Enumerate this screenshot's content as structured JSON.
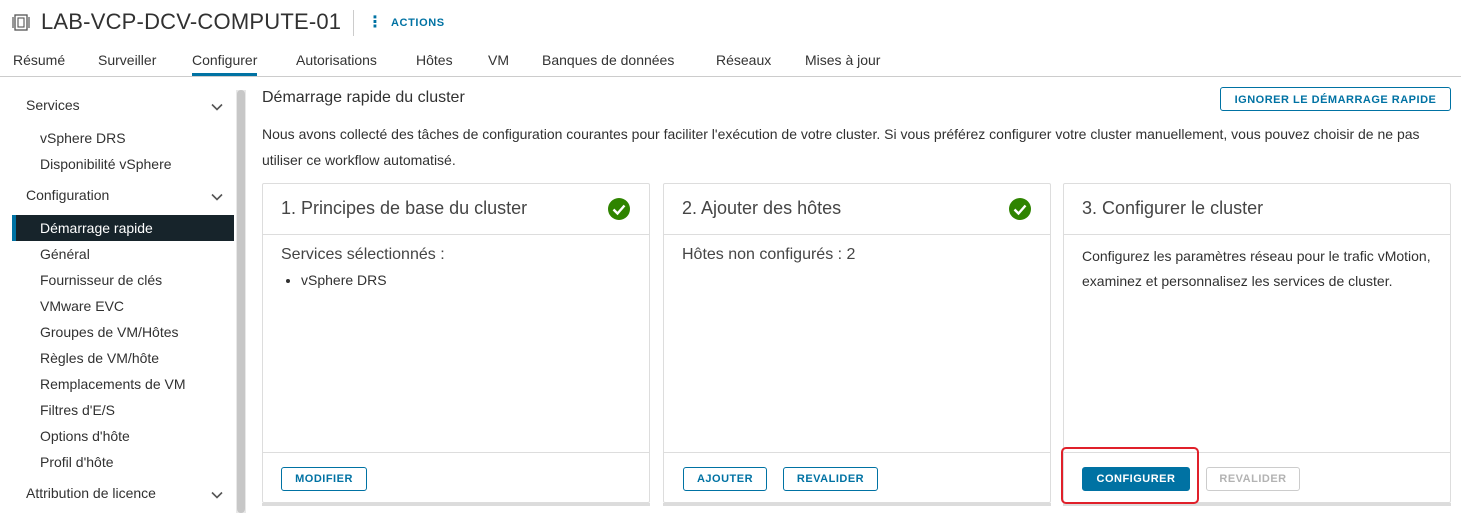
{
  "header": {
    "title": "LAB-VCP-DCV-COMPUTE-01",
    "actions_label": "ACTIONS",
    "icon": "cluster-icon"
  },
  "tabs": [
    {
      "label": "Résumé",
      "active": false
    },
    {
      "label": "Surveiller",
      "active": false
    },
    {
      "label": "Configurer",
      "active": true
    },
    {
      "label": "Autorisations",
      "active": false
    },
    {
      "label": "Hôtes",
      "active": false
    },
    {
      "label": "VM",
      "active": false
    },
    {
      "label": "Banques de données",
      "active": false
    },
    {
      "label": "Réseaux",
      "active": false
    },
    {
      "label": "Mises à jour",
      "active": false
    }
  ],
  "sidebar": {
    "groups": [
      {
        "label": "Services",
        "items": [
          "vSphere DRS",
          "Disponibilité vSphere"
        ]
      },
      {
        "label": "Configuration",
        "items": [
          "Démarrage rapide",
          "Général",
          "Fournisseur de clés",
          "VMware EVC",
          "Groupes de VM/Hôtes",
          "Règles de VM/hôte",
          "Remplacements de VM",
          "Filtres d'E/S",
          "Options d'hôte",
          "Profil d'hôte"
        ]
      },
      {
        "label": "Attribution de licence",
        "items": []
      }
    ],
    "active_item": "Démarrage rapide"
  },
  "main": {
    "title": "Démarrage rapide du cluster",
    "ignore_button": "IGNORER LE DÉMARRAGE RAPIDE",
    "description": "Nous avons collecté des tâches de configuration courantes pour faciliter l'exécution de votre cluster. Si vous préférez configurer votre cluster manuellement, vous pouvez choisir de ne pas utiliser ce workflow automatisé.",
    "cards": [
      {
        "title": "1. Principes de base du cluster",
        "completed": true,
        "subtitle": "Services sélectionnés :",
        "list": [
          "vSphere DRS"
        ],
        "buttons": [
          {
            "label": "MODIFIER",
            "style": "outline"
          }
        ]
      },
      {
        "title": "2. Ajouter des hôtes",
        "completed": true,
        "subtitle": "Hôtes non configurés : 2",
        "buttons": [
          {
            "label": "AJOUTER",
            "style": "outline"
          },
          {
            "label": "REVALIDER",
            "style": "outline"
          }
        ]
      },
      {
        "title": "3. Configurer le cluster",
        "completed": false,
        "text": "Configurez les paramètres réseau pour le trafic vMotion, examinez et personnalisez les services de cluster.",
        "buttons": [
          {
            "label": "CONFIGURER",
            "style": "primary"
          },
          {
            "label": "REVALIDER",
            "style": "disabled"
          }
        ]
      }
    ]
  },
  "colors": {
    "accent": "#0072a3",
    "success": "#2f8400",
    "active_nav_bg": "#17242b",
    "highlight": "#e0202a"
  }
}
